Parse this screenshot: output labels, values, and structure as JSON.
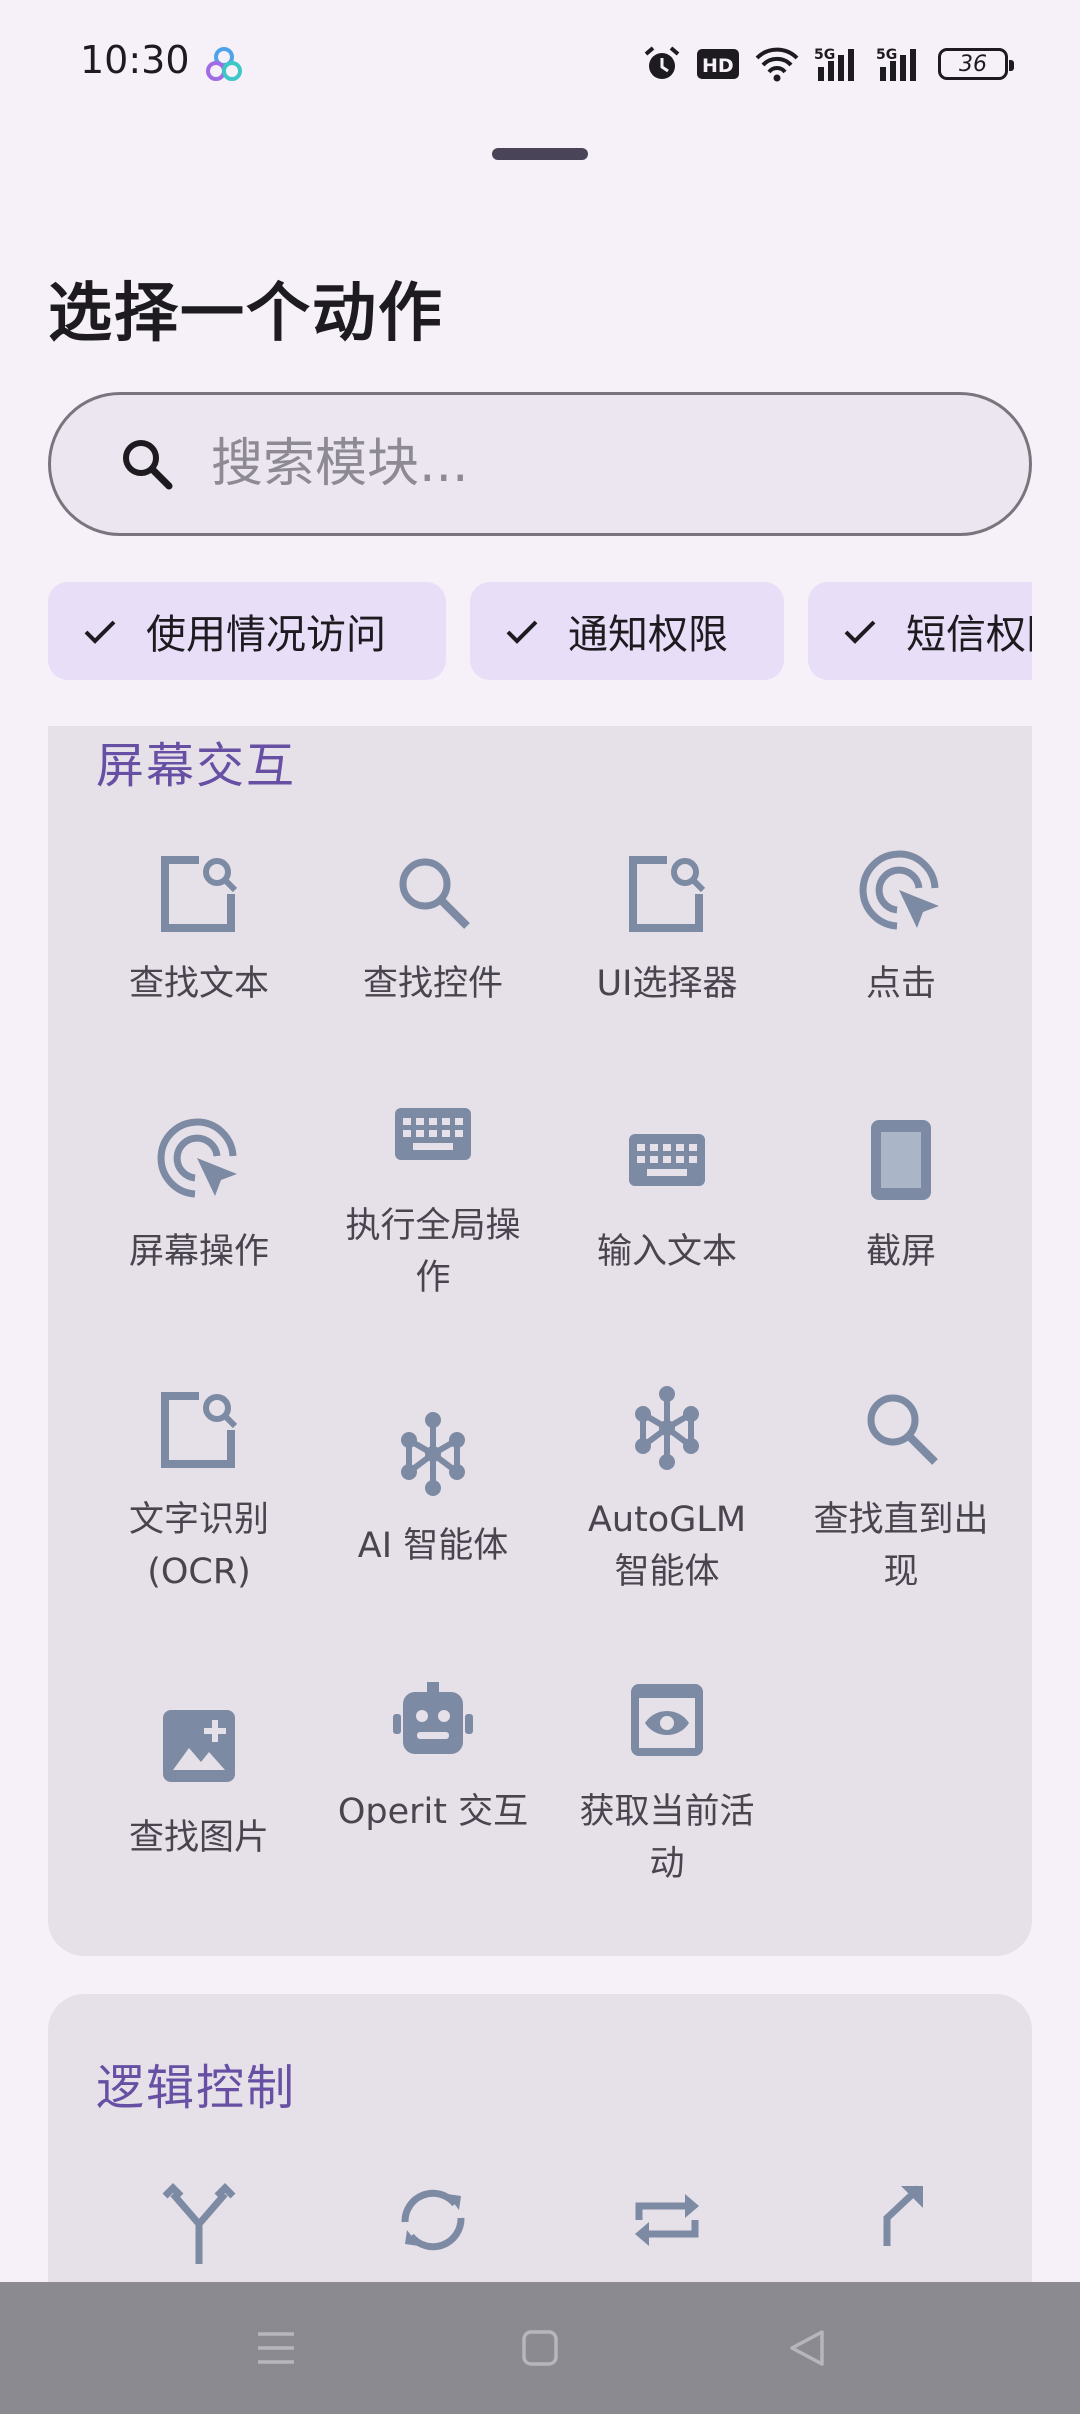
{
  "status_bar": {
    "time": "10:30",
    "battery": "36",
    "icons": [
      "alarm-icon",
      "hd-icon",
      "wifi-icon",
      "signal-5g-icon",
      "signal-5g-icon",
      "battery-icon"
    ]
  },
  "title": "选择一个动作",
  "search": {
    "placeholder": "搜索模块..."
  },
  "chips": [
    {
      "label": "使用情况访问"
    },
    {
      "label": "通知权限"
    },
    {
      "label": "短信权限"
    }
  ],
  "sections": [
    {
      "title": "屏幕交互",
      "items": [
        {
          "label": "查找文本",
          "icon": "find-text-icon"
        },
        {
          "label": "查找控件",
          "icon": "search-icon"
        },
        {
          "label": "UI选择器",
          "icon": "find-text-icon"
        },
        {
          "label": "点击",
          "icon": "tap-icon"
        },
        {
          "label": "屏幕操作",
          "icon": "tap-icon"
        },
        {
          "label": "执行全局操作",
          "icon": "keyboard-icon"
        },
        {
          "label": "输入文本",
          "icon": "keyboard-icon"
        },
        {
          "label": "截屏",
          "icon": "phone-icon"
        },
        {
          "label": "文字识别 (OCR)",
          "icon": "find-text-icon"
        },
        {
          "label": "AI 智能体",
          "icon": "hub-icon"
        },
        {
          "label": "AutoGLM 智能体",
          "icon": "hub-icon"
        },
        {
          "label": "查找直到出现",
          "icon": "search-icon"
        },
        {
          "label": "查找图片",
          "icon": "add-image-icon"
        },
        {
          "label": "Operit 交互",
          "icon": "robot-icon"
        },
        {
          "label": "获取当前活动",
          "icon": "eye-window-icon"
        }
      ]
    },
    {
      "title": "逻辑控制",
      "items": [
        {
          "label": "",
          "icon": "branch-icon"
        },
        {
          "label": "",
          "icon": "loop-icon"
        },
        {
          "label": "",
          "icon": "repeat-icon"
        },
        {
          "label": "",
          "icon": "jump-icon"
        }
      ]
    }
  ],
  "navigation": [
    "menu-icon",
    "home-icon",
    "back-icon"
  ],
  "colors": {
    "background": "#f6f1f8",
    "card": "#e6e0e9",
    "chip": "#e8def8",
    "accent": "#6750a4",
    "icon": "#7d8aa3"
  }
}
